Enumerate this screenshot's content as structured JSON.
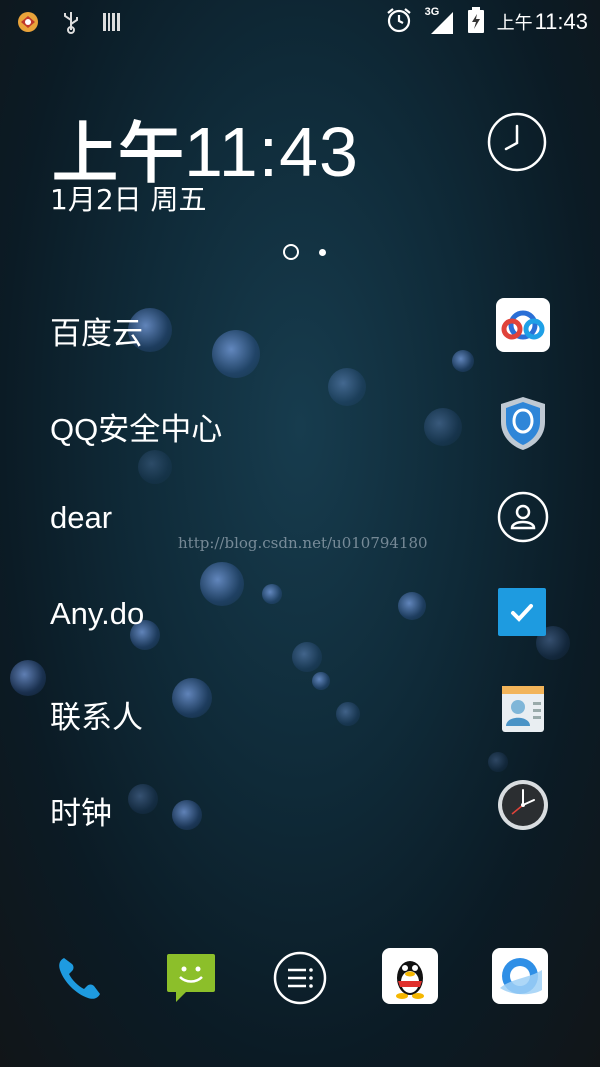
{
  "status_bar": {
    "network": "3G",
    "time_prefix": "上午",
    "time": "11:43"
  },
  "clock": {
    "prefix": "上午",
    "time": "11:43",
    "date": "1月2日 周五"
  },
  "page_indicator": {
    "pages": 2,
    "current": 2
  },
  "apps": [
    {
      "label": "百度云",
      "icon": "baidu-cloud-icon"
    },
    {
      "label": "QQ安全中心",
      "icon": "qq-security-shield-icon"
    },
    {
      "label": "dear",
      "icon": "person-icon"
    },
    {
      "label": "Any.do",
      "icon": "anydo-check-icon"
    },
    {
      "label": "联系人",
      "icon": "contacts-icon"
    },
    {
      "label": "时钟",
      "icon": "clock-app-icon"
    }
  ],
  "dock": [
    "phone-icon",
    "messaging-icon",
    "app-drawer-icon",
    "qq-penguin-icon",
    "browser-icon"
  ],
  "watermark": "http://blog.csdn.net/u010794180",
  "colors": {
    "accent_blue": "#1e9be0",
    "messaging_green": "#8cbf2a",
    "anydo_blue": "#1e9be0"
  }
}
